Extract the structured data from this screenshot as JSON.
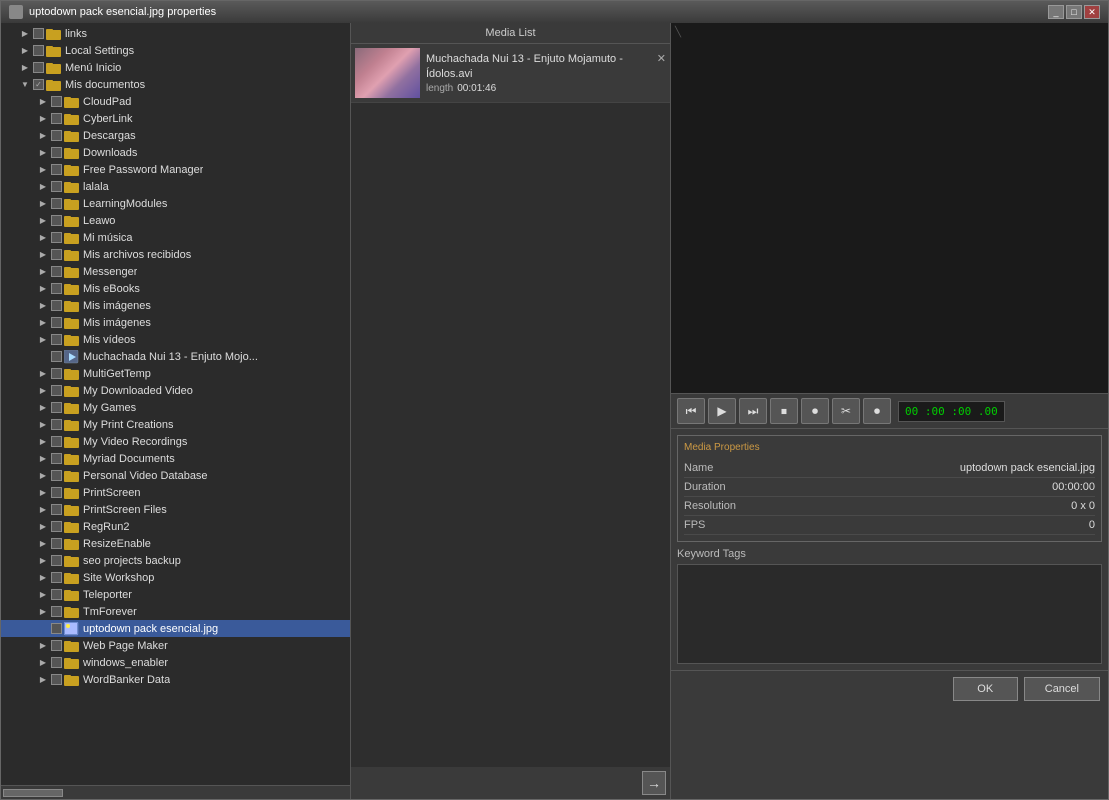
{
  "window": {
    "title": "uptodown pack esencial.jpg properties",
    "icon": "image-icon"
  },
  "titleBtns": [
    "_",
    "□",
    "✕"
  ],
  "fileTree": {
    "items": [
      {
        "id": "links",
        "label": "links",
        "type": "folder",
        "level": 1,
        "expanded": false,
        "checked": false
      },
      {
        "id": "local-settings",
        "label": "Local Settings",
        "type": "folder",
        "level": 1,
        "expanded": false,
        "checked": false
      },
      {
        "id": "menu-inicio",
        "label": "Menú Inicio",
        "type": "folder",
        "level": 1,
        "expanded": false,
        "checked": false
      },
      {
        "id": "mis-documentos",
        "label": "Mis documentos",
        "type": "folder",
        "level": 1,
        "expanded": true,
        "checked": true
      },
      {
        "id": "cloudpad",
        "label": "CloudPad",
        "type": "folder",
        "level": 2,
        "expanded": false,
        "checked": false
      },
      {
        "id": "cyberlink",
        "label": "CyberLink",
        "type": "folder",
        "level": 2,
        "expanded": false,
        "checked": false
      },
      {
        "id": "descargas",
        "label": "Descargas",
        "type": "folder",
        "level": 2,
        "expanded": false,
        "checked": false
      },
      {
        "id": "downloads",
        "label": "Downloads",
        "type": "folder",
        "level": 2,
        "expanded": false,
        "checked": false
      },
      {
        "id": "free-password-manager",
        "label": "Free Password Manager",
        "type": "folder",
        "level": 2,
        "expanded": false,
        "checked": false
      },
      {
        "id": "lalala",
        "label": "lalala",
        "type": "folder",
        "level": 2,
        "expanded": false,
        "checked": false
      },
      {
        "id": "learningmodules",
        "label": "LearningModules",
        "type": "folder",
        "level": 2,
        "expanded": false,
        "checked": false
      },
      {
        "id": "leawo",
        "label": "Leawo",
        "type": "folder",
        "level": 2,
        "expanded": false,
        "checked": false
      },
      {
        "id": "mi-musica",
        "label": "Mi música",
        "type": "folder",
        "level": 2,
        "expanded": false,
        "checked": false
      },
      {
        "id": "mis-archivos-recibidos",
        "label": "Mis archivos recibidos",
        "type": "folder",
        "level": 2,
        "expanded": false,
        "checked": false
      },
      {
        "id": "messenger",
        "label": "Messenger",
        "type": "folder",
        "level": 2,
        "expanded": false,
        "checked": false
      },
      {
        "id": "mis-ebooks",
        "label": "Mis eBooks",
        "type": "folder",
        "level": 2,
        "expanded": false,
        "checked": false
      },
      {
        "id": "mis-imagenes-1",
        "label": "Mis imágenes",
        "type": "folder",
        "level": 2,
        "expanded": false,
        "checked": false
      },
      {
        "id": "mis-imagenes-2",
        "label": "Mis imágenes",
        "type": "folder",
        "level": 2,
        "expanded": false,
        "checked": false
      },
      {
        "id": "mis-videos",
        "label": "Mis vídeos",
        "type": "folder",
        "level": 2,
        "expanded": false,
        "checked": false
      },
      {
        "id": "muchachada",
        "label": "Muchachada Nui 13 - Enjuto Mojo...",
        "type": "file",
        "level": 2,
        "expanded": false,
        "checked": false
      },
      {
        "id": "multigettemp",
        "label": "MultiGetTemp",
        "type": "folder",
        "level": 2,
        "expanded": false,
        "checked": false
      },
      {
        "id": "my-downloaded-video",
        "label": "My Downloaded Video",
        "type": "folder",
        "level": 2,
        "expanded": false,
        "checked": false
      },
      {
        "id": "my-games",
        "label": "My Games",
        "type": "folder",
        "level": 2,
        "expanded": false,
        "checked": false
      },
      {
        "id": "my-print-creations",
        "label": "My Print Creations",
        "type": "folder",
        "level": 2,
        "expanded": false,
        "checked": false
      },
      {
        "id": "my-video-recordings",
        "label": "My Video Recordings",
        "type": "folder",
        "level": 2,
        "expanded": false,
        "checked": false
      },
      {
        "id": "myriad-documents",
        "label": "Myriad Documents",
        "type": "folder",
        "level": 2,
        "expanded": false,
        "checked": false
      },
      {
        "id": "personal-video-database",
        "label": "Personal Video Database",
        "type": "folder",
        "level": 2,
        "expanded": false,
        "checked": false
      },
      {
        "id": "printscreen",
        "label": "PrintScreen",
        "type": "folder",
        "level": 2,
        "expanded": false,
        "checked": false
      },
      {
        "id": "printscreen-files",
        "label": "PrintScreen Files",
        "type": "folder",
        "level": 2,
        "expanded": false,
        "checked": false
      },
      {
        "id": "regrun2",
        "label": "RegRun2",
        "type": "folder",
        "level": 2,
        "expanded": false,
        "checked": false
      },
      {
        "id": "resizeenable",
        "label": "ResizeEnable",
        "type": "folder",
        "level": 2,
        "expanded": false,
        "checked": false
      },
      {
        "id": "seo-projects-backup",
        "label": "seo projects backup",
        "type": "folder",
        "level": 2,
        "expanded": false,
        "checked": false
      },
      {
        "id": "site-workshop",
        "label": "Site Workshop",
        "type": "folder",
        "level": 2,
        "expanded": false,
        "checked": false
      },
      {
        "id": "teleporter",
        "label": "Teleporter",
        "type": "folder",
        "level": 2,
        "expanded": false,
        "checked": false
      },
      {
        "id": "tmforever",
        "label": "TmForever",
        "type": "folder",
        "level": 2,
        "expanded": false,
        "checked": false
      },
      {
        "id": "uptodown-pack",
        "label": "uptodown pack esencial.jpg",
        "type": "file",
        "level": 2,
        "expanded": false,
        "checked": false,
        "selected": true
      },
      {
        "id": "web-page-maker",
        "label": "Web Page Maker",
        "type": "folder",
        "level": 2,
        "expanded": false,
        "checked": false
      },
      {
        "id": "windows-enabler",
        "label": "windows_enabler",
        "type": "folder",
        "level": 2,
        "expanded": false,
        "checked": false
      },
      {
        "id": "wordbanker-data",
        "label": "WordBanker Data",
        "type": "folder",
        "level": 2,
        "expanded": false,
        "checked": false
      }
    ]
  },
  "mediaList": {
    "header": "Media List",
    "items": [
      {
        "title": "Muchachada Nui 13 - Enjuto Mojamuto - Ídolos.avi",
        "lengthLabel": "length",
        "lengthValue": "00:01:46"
      }
    ],
    "addBtnLabel": "→"
  },
  "transport": {
    "buttons": [
      "⏮",
      "▶",
      "⏭",
      "⏹",
      "⏺",
      "✂",
      "⏺"
    ],
    "timeDisplay": "00 :00 :00 .00"
  },
  "mediaProperties": {
    "sectionTitle": "Media Properties",
    "properties": [
      {
        "label": "Name",
        "value": "uptodown pack esencial.jpg"
      },
      {
        "label": "Duration",
        "value": "00:00:00"
      },
      {
        "label": "Resolution",
        "value": "0 x 0"
      },
      {
        "label": "FPS",
        "value": "0"
      }
    ]
  },
  "keywordTags": {
    "label": "Keyword Tags"
  },
  "dialog": {
    "okLabel": "OK",
    "cancelLabel": "Cancel"
  }
}
